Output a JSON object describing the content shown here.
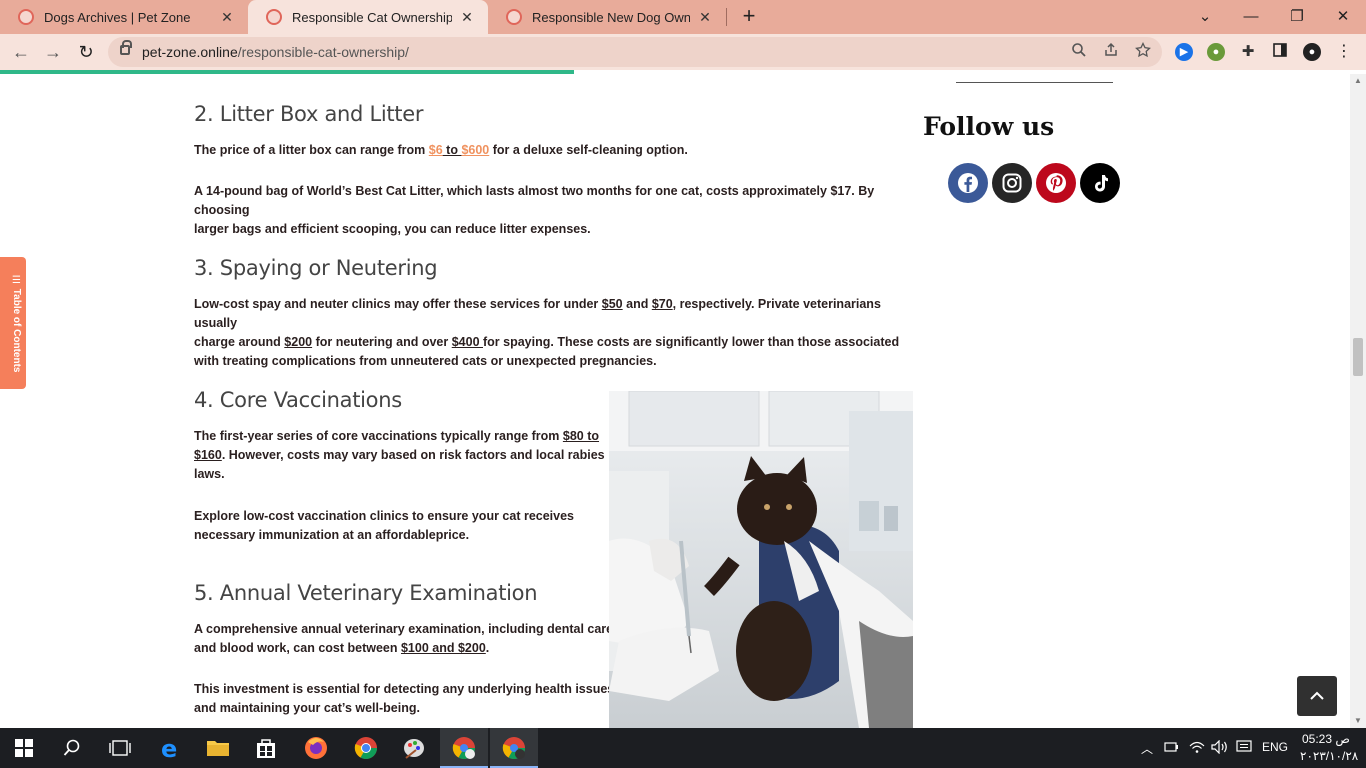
{
  "browser": {
    "tabs": [
      {
        "title": "Dogs Archives | Pet Zone",
        "close": "✕"
      },
      {
        "title": "Responsible Cat Ownership: Fina",
        "close": "✕"
      },
      {
        "title": "Responsible New Dog Ownershi",
        "close": "✕"
      }
    ],
    "new_tab": "+",
    "window": {
      "minimize": "⌄",
      "restore": "—",
      "maximize": "❐",
      "close": "✕"
    },
    "nav": {
      "back": "←",
      "forward": "→",
      "reload": "↻"
    },
    "url_host": "pet-zone.online",
    "url_path": "/responsible-cat-ownership/",
    "load_progress": 0.42
  },
  "toc": {
    "label": "Table of Contents"
  },
  "article": {
    "sections": [
      {
        "heading": "2. Litter Box and Litter",
        "p1_pre": "The price of a litter box can range from ",
        "p1_link_a": "$6",
        "p1_to": " to ",
        "p1_link_b": "$600",
        "p1_post": " for a deluxe self-cleaning option.",
        "p2_line1": "A 14-pound bag of World’s Best Cat Litter, which lasts almost two months for one cat, costs approximately $17. By choosing",
        "p2_line2": "larger bags and efficient scooping, you can reduce litter expenses."
      },
      {
        "heading": "3. Spaying or Neutering",
        "l1_a": "Low-cost spay and neuter clinics may offer these services for under ",
        "l1_u1": "$50",
        "l1_b": " and ",
        "l1_u2": "$70",
        "l1_c": ", respectively. Private veterinarians usually",
        "l2_a": "charge around ",
        "l2_u1": "$200",
        "l2_b": " for neutering and over ",
        "l2_u2": "$400 ",
        "l2_c": "for spaying. These costs are significantly lower than those associated",
        "l3": "with treating complications from unneutered cats or unexpected pregnancies."
      },
      {
        "heading": "4. Core Vaccinations",
        "l1_a": "The first-year series of core vaccinations typically range from ",
        "l1_u": "$80 to",
        "l2_u": "$160",
        "l2_b": ". However, costs may vary based on risk factors and local rabies",
        "l3": "laws.",
        "p2_l1": "Explore low-cost vaccination clinics to ensure your cat receives",
        "p2_l2": "necessary immunization at an affordableprice."
      },
      {
        "heading": "5. Annual Veterinary Examination",
        "l1": "A comprehensive annual veterinary examination, including dental care",
        "l2_a": "and blood work, can cost between ",
        "l2_u": "$100 and $200",
        "l2_b": ".",
        "p2_l1": "This investment is essential for detecting any underlying health issues",
        "p2_l2": "and maintaining your cat’s well-being."
      }
    ]
  },
  "sidebar": {
    "follow_title": "Follow us",
    "social": [
      {
        "icon": "facebook-icon",
        "color": "#3b5998"
      },
      {
        "icon": "instagram-icon",
        "color": "#262626"
      },
      {
        "icon": "pinterest-icon",
        "color": "#bd081c"
      },
      {
        "icon": "tiktok-icon",
        "color": "#000000"
      }
    ]
  },
  "taskbar": {
    "language": "ENG",
    "time": "05:23 ص",
    "date": "٢٠٢٣/١٠/٢٨"
  }
}
